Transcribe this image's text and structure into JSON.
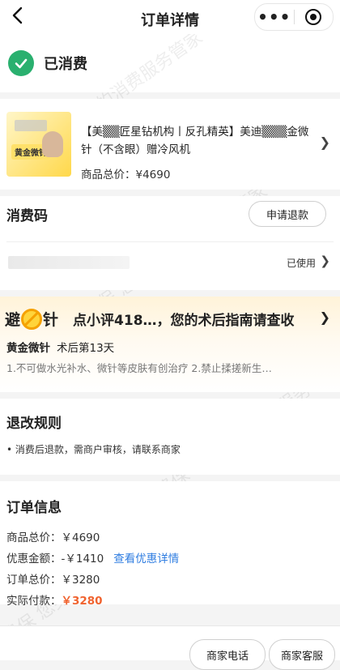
{
  "nav": {
    "title": "订单详情",
    "more_label": "•••"
  },
  "status": {
    "text": "已消费"
  },
  "product": {
    "name": "【美▒▒匠星钻机构丨反孔精英】美迪▒▒▒金微针（不含眼）赠冷风机",
    "thumb_label": "黄金微针",
    "total_price": "商品总价：¥4690"
  },
  "code": {
    "title": "消费码",
    "refund_button": "申请退款",
    "used_label": "已使用"
  },
  "guide": {
    "avoid_label": "避",
    "needle_label": "针",
    "message": "点小评418…，您的术后指南请查收",
    "project": "黄金微针",
    "day": "术后第13天",
    "tips": "1.不可做水光补水、微针等皮肤有创治疗 2.禁止揉搓新生…"
  },
  "rules": {
    "title": "退改规则",
    "item": "• 消费后退款，需商户审核，请联系商家"
  },
  "order_info": {
    "title": "订单信息",
    "goods_total": "商品总价：￥4690",
    "discount": "优惠金额：-￥1410",
    "discount_link": "查看优惠详情",
    "order_total": "订单总价：￥3280",
    "paid_label": "实际付款：",
    "paid_value": "￥3280"
  },
  "bottom": {
    "phone_button": "商家电话",
    "service_button": "商家客服"
  },
  "watermark": "消费保 您身边的消费服务管家",
  "colors": {
    "success": "#2ab06f",
    "link": "#2f7de1",
    "price": "#f0632f"
  }
}
